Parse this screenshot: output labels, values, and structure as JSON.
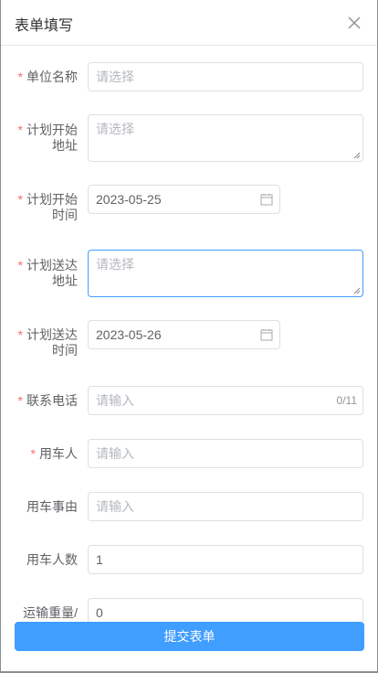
{
  "dialog": {
    "title": "表单填写",
    "close_icon": "close-icon",
    "submit_label": "提交表单"
  },
  "form": {
    "unit_name": {
      "label": "单位名称",
      "required": true,
      "placeholder": "请选择"
    },
    "start_addr": {
      "label_1": "计划开始",
      "label_2": "地址",
      "required": true,
      "placeholder": "请选择"
    },
    "start_time": {
      "label_1": "计划开始",
      "label_2": "时间",
      "required": true,
      "value": "2023-05-25",
      "icon": "calendar-icon"
    },
    "dest_addr": {
      "label_1": "计划送达",
      "label_2": "地址",
      "required": true,
      "placeholder": "请选择",
      "focused": true
    },
    "dest_time": {
      "label_1": "计划送达",
      "label_2": "时间",
      "required": true,
      "value": "2023-05-26",
      "icon": "calendar-icon"
    },
    "phone": {
      "label": "联系电话",
      "required": true,
      "placeholder": "请输入",
      "counter": "0/11"
    },
    "user": {
      "label": "用车人",
      "required": true,
      "placeholder": "请输入"
    },
    "reason": {
      "label": "用车事由",
      "required": false,
      "placeholder": "请输入"
    },
    "user_count": {
      "label": "用车人数",
      "required": false,
      "value": "1"
    },
    "weight": {
      "label": "运输重量/",
      "required": false,
      "value": "0"
    }
  },
  "colors": {
    "required": "#f56c6c",
    "primary": "#409eff",
    "focus_border": "#409eff"
  }
}
